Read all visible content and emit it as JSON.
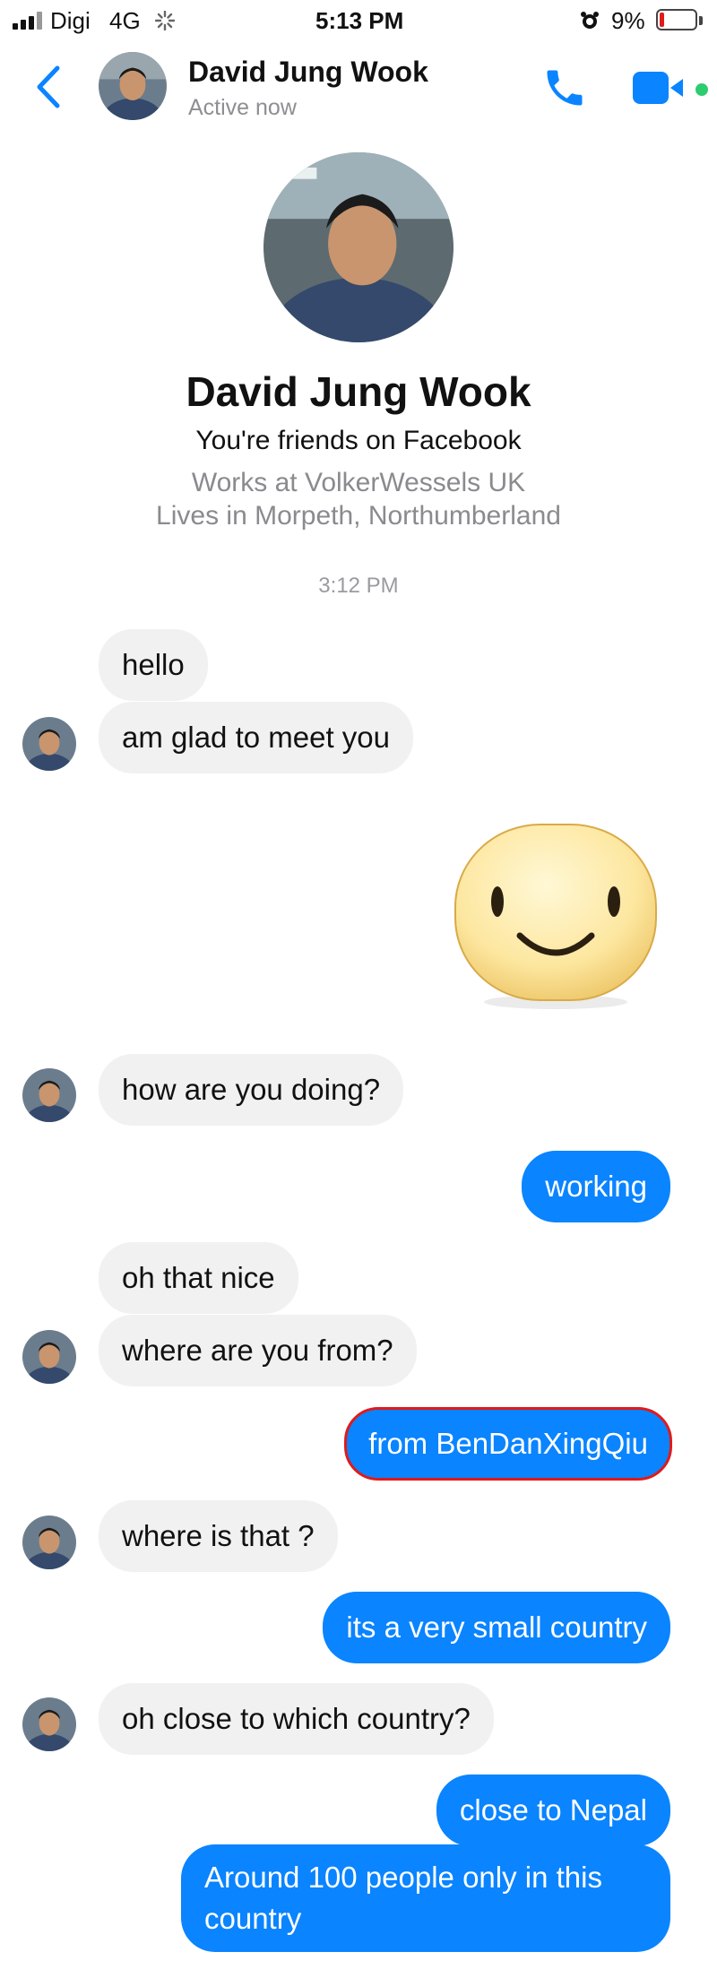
{
  "status_bar": {
    "carrier": "Digi",
    "network": "4G",
    "time": "5:13 PM",
    "battery": "9%"
  },
  "header": {
    "contact_name": "David Jung Wook",
    "presence": "Active now"
  },
  "profile": {
    "name": "David Jung Wook",
    "friend_status": "You're friends on Facebook",
    "work": "Works at VolkerWessels UK",
    "location": "Lives in Morpeth, Northumberland"
  },
  "timestamp": "3:12 PM",
  "messages": [
    {
      "from": "them",
      "text": "hello"
    },
    {
      "from": "them",
      "text": "am glad to meet you"
    },
    {
      "from": "me",
      "text": "",
      "sticker": "smiley-face"
    },
    {
      "from": "them",
      "text": "how are you doing?"
    },
    {
      "from": "me",
      "text": "working"
    },
    {
      "from": "them",
      "text": "oh that nice"
    },
    {
      "from": "them",
      "text": "where are you from?"
    },
    {
      "from": "me",
      "text": "from BenDanXingQiu",
      "highlighted": true
    },
    {
      "from": "them",
      "text": "where is that ?"
    },
    {
      "from": "me",
      "text": "its a very small country"
    },
    {
      "from": "them",
      "text": "oh close to which country?"
    },
    {
      "from": "me",
      "text": "close to Nepal"
    },
    {
      "from": "me",
      "text": "Around 100 people only in this country"
    }
  ],
  "colors": {
    "accent": "#0a84ff",
    "incoming_bubble": "#f1f1f2",
    "highlight": "#e01a1a",
    "active_dot": "#2ecc71"
  }
}
